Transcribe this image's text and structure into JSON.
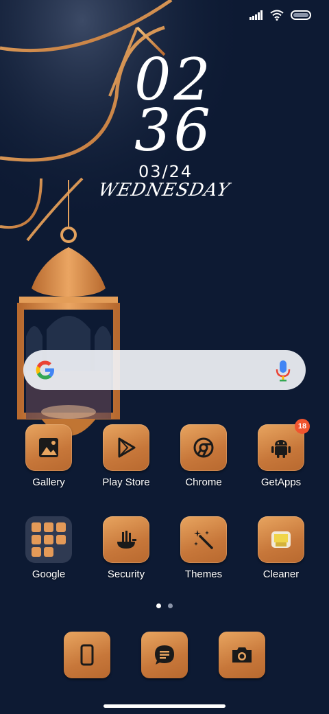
{
  "status_bar": {
    "icons": [
      "signal-icon",
      "wifi-icon",
      "battery-icon"
    ]
  },
  "clock": {
    "hour": "02",
    "minute": "36",
    "date": "03/24",
    "weekday": "WEDNESDAY"
  },
  "search": {
    "icons": [
      "google-g-icon",
      "microphone-icon"
    ]
  },
  "apps_row1": [
    {
      "label": "Gallery",
      "icon": "gallery-icon"
    },
    {
      "label": "Play Store",
      "icon": "play-store-icon"
    },
    {
      "label": "Chrome",
      "icon": "chrome-icon"
    },
    {
      "label": "GetApps",
      "icon": "android-icon",
      "badge": "18"
    }
  ],
  "apps_row2": [
    {
      "label": "Google",
      "icon": "folder-icon"
    },
    {
      "label": "Security",
      "icon": "security-icon"
    },
    {
      "label": "Themes",
      "icon": "magic-wand-icon"
    },
    {
      "label": "Cleaner",
      "icon": "cleaner-icon"
    }
  ],
  "page_indicator": {
    "pages": 2,
    "current": 1
  },
  "dock": [
    {
      "icon": "phone-icon"
    },
    {
      "icon": "messages-icon"
    },
    {
      "icon": "camera-icon"
    }
  ],
  "colors": {
    "background": "#0d1a33",
    "accent_copper": "#d08646",
    "badge": "#f0542e"
  }
}
